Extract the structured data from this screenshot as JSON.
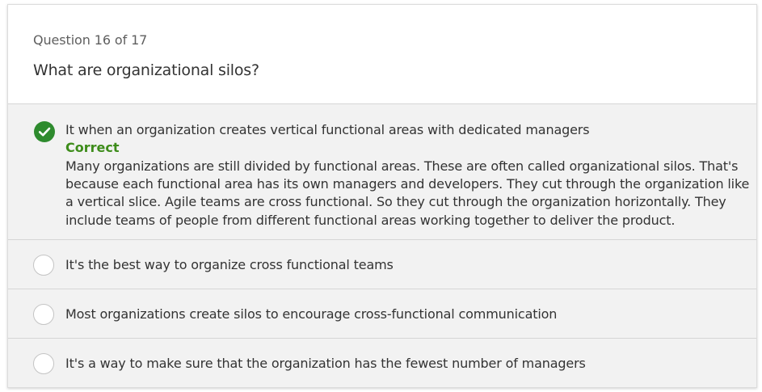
{
  "question": {
    "counter": "Question 16 of 17",
    "text": "What are organizational silos?"
  },
  "answers": [
    {
      "text": "It when an organization creates vertical functional areas with dedicated managers",
      "selected": true,
      "status": "Correct",
      "explanation": "Many organizations are still divided by functional areas. These are often called organizational silos. That's because each functional area has its own managers and developers. They cut through the organization like a vertical slice. Agile teams are cross functional. So they cut through the organization horizontally. They include teams of people from different functional areas working together to deliver the product."
    },
    {
      "text": "It's the best way to organize cross functional teams",
      "selected": false
    },
    {
      "text": "Most organizations create silos to encourage cross-functional communication",
      "selected": false
    },
    {
      "text": "It's a way to make sure that the organization has the fewest number of managers",
      "selected": false
    }
  ],
  "colors": {
    "correct_green": "#2e8b2e",
    "correct_text": "#3d8c1a",
    "answers_background": "#f2f2f2"
  },
  "icons": {
    "selected": "check-circle-icon",
    "unselected": "radio-circle-icon"
  }
}
